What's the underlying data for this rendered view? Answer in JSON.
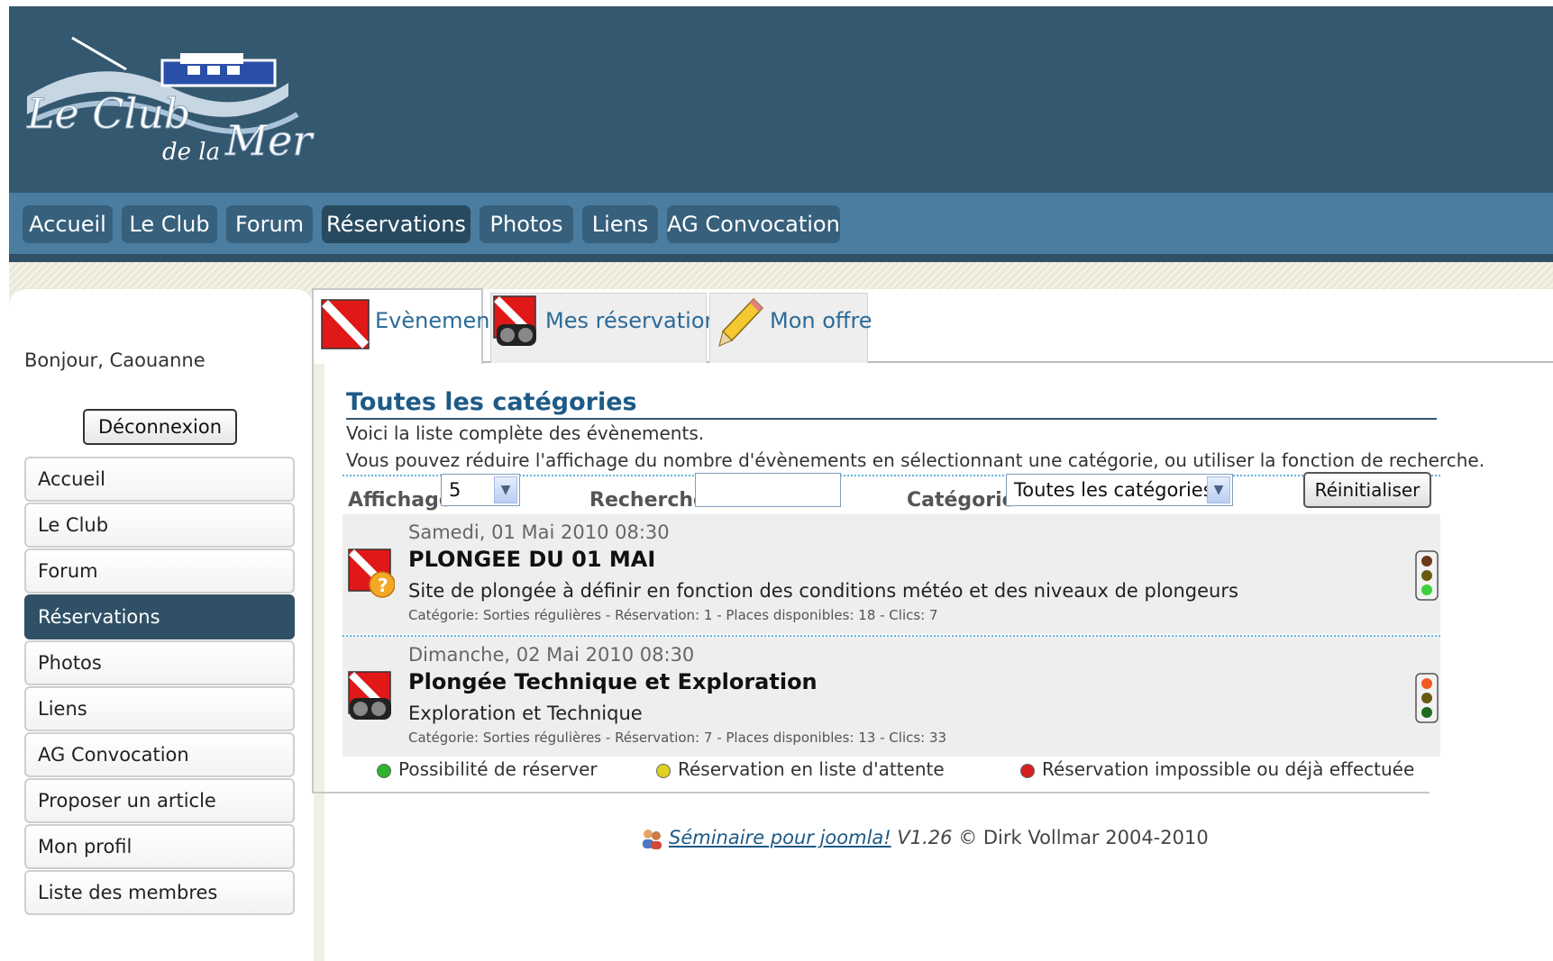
{
  "header": {
    "logo_text": "Le Club de la Mer"
  },
  "topnav": {
    "items": [
      {
        "label": "Accueil"
      },
      {
        "label": "Le Club"
      },
      {
        "label": "Forum"
      },
      {
        "label": "Réservations",
        "active": true
      },
      {
        "label": "Photos"
      },
      {
        "label": "Liens"
      },
      {
        "label": "AG Convocation"
      }
    ]
  },
  "sidebar": {
    "greeting": "Bonjour, Caouanne",
    "logout_label": "Déconnexion",
    "items": [
      {
        "label": "Accueil"
      },
      {
        "label": "Le Club"
      },
      {
        "label": "Forum"
      },
      {
        "label": "Réservations",
        "active": true
      },
      {
        "label": "Photos"
      },
      {
        "label": "Liens"
      },
      {
        "label": "AG Convocation"
      },
      {
        "label": "Proposer un article"
      },
      {
        "label": "Mon profil"
      },
      {
        "label": "Liste des membres"
      }
    ]
  },
  "tabs": [
    {
      "label": "Evènement",
      "icon": "dive-flag-icon",
      "active": true
    },
    {
      "label": "Mes réservations",
      "icon": "dive-flag-mask-icon"
    },
    {
      "label": "Mon offre",
      "icon": "pencil-icon"
    }
  ],
  "content": {
    "category_heading": "Toutes les catégories",
    "intro_line1": "Voici la liste complète des évènements.",
    "intro_line2": "Vous pouvez réduire l'affichage du nombre d'évènements en sélectionnant une catégorie, ou utiliser la fonction de recherche.",
    "filters": {
      "display_label": "Affichage",
      "display_value": "5",
      "search_label": "Recherche:",
      "search_value": "",
      "category_label": "Catégorie:",
      "category_value": "Toutes les catégories",
      "reset_label": "Réinitialiser"
    },
    "events": [
      {
        "date": "Samedi, 01 Mai 2010 08:30",
        "title": "PLONGEE DU 01 MAI",
        "description": "Site de plongée à définir en fonction des conditions météo et des niveaux de plongeurs",
        "meta": "Catégorie: Sorties régulières - Réservation: 1 - Places disponibles: 18 - Clics: 7",
        "icon": "dive-flag-question-icon",
        "status_light": "green"
      },
      {
        "date": "Dimanche, 02 Mai 2010 08:30",
        "title": "Plongée Technique et Exploration",
        "description": "Exploration et Technique",
        "meta": "Catégorie: Sorties régulières - Réservation: 7 - Places disponibles: 13 - Clics: 33",
        "icon": "dive-flag-mask-icon",
        "status_light": "red"
      }
    ],
    "legend": [
      {
        "label": "Possibilité de réserver",
        "color": "#2db32d"
      },
      {
        "label": "Réservation en liste d'attente",
        "color": "#e0d020"
      },
      {
        "label": "Réservation impossible ou déjà effectuée",
        "color": "#d42020"
      }
    ]
  },
  "footer": {
    "link_text": "Séminaire pour joomla!",
    "version": "V1.26",
    "copyright": "© Dirk Vollmar 2004-2010"
  },
  "colors": {
    "header_bg": "#34586f",
    "nav_bg": "#4a7d9f",
    "accent_link": "#1d5a86"
  }
}
